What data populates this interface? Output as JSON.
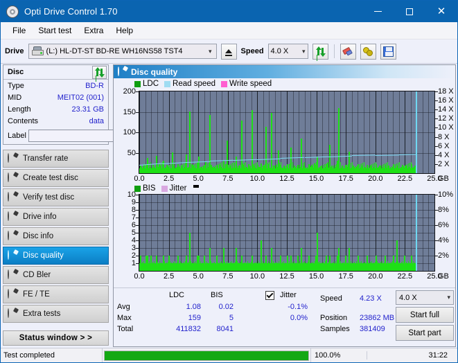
{
  "window": {
    "title": "Opti Drive Control 1.70",
    "icon": "disc-icon",
    "minimize": "–",
    "maximize": "□",
    "close": "✕"
  },
  "menu": {
    "items": [
      {
        "label": "File"
      },
      {
        "label": "Start test"
      },
      {
        "label": "Extra"
      },
      {
        "label": "Help"
      }
    ]
  },
  "toolbar": {
    "drive_label": "Drive",
    "drive_value": "(L:)  HL-DT-ST BD-RE  WH16NS58 TST4",
    "drive_chevron": "⌵",
    "eject_title": "eject-button",
    "speed_label": "Speed",
    "speed_value": "4.0 X",
    "speed_chevron": "⌵",
    "icons": [
      "refresh-icon",
      "eraser-icon",
      "plug-icon",
      "save-icon"
    ]
  },
  "sidebar": {
    "disc_panel": {
      "title": "Disc",
      "refresh_icon": "refresh-icon",
      "rows": [
        {
          "key": "Type",
          "value": "BD-R"
        },
        {
          "key": "MID",
          "value": "MEIT02 (001)"
        },
        {
          "key": "Length",
          "value": "23.31 GB"
        },
        {
          "key": "Contents",
          "value": "data"
        }
      ],
      "label_key": "Label",
      "label_value": "",
      "label_placeholder": "",
      "label_button_icon": "cd-icon"
    },
    "nav": [
      {
        "label": "Transfer rate",
        "active": false
      },
      {
        "label": "Create test disc",
        "active": false
      },
      {
        "label": "Verify test disc",
        "active": false
      },
      {
        "label": "Drive info",
        "active": false
      },
      {
        "label": "Disc info",
        "active": false
      },
      {
        "label": "Disc quality",
        "active": true
      },
      {
        "label": "CD Bler",
        "active": false
      },
      {
        "label": "FE / TE",
        "active": false
      },
      {
        "label": "Extra tests",
        "active": false
      }
    ],
    "status_window_button": "Status window > >"
  },
  "content": {
    "header_title": "Disc quality",
    "header_icon": "disc-quality-icon"
  },
  "stats": {
    "col_headers": [
      "LDC",
      "BIS"
    ],
    "row_labels": [
      "Avg",
      "Max",
      "Total"
    ],
    "ldc": {
      "avg": "1.08",
      "max": "159",
      "total": "411832"
    },
    "bis": {
      "avg": "0.02",
      "max": "5",
      "total": "8041"
    },
    "jitter": {
      "label": "Jitter",
      "checked": true,
      "avg": "-0.1%",
      "max": "0.0%"
    },
    "speed_label": "Speed",
    "speed_value": "4.23 X",
    "position_label": "Position",
    "position_value": "23862 MB",
    "samples_label": "Samples",
    "samples_value": "381409",
    "speed_select_value": "4.0 X",
    "speed_select_chevron": "⌵",
    "start_full": "Start full",
    "start_part": "Start part"
  },
  "statusbar": {
    "text": "Test completed",
    "percent_label": "100.0%",
    "percent_value": 100,
    "time": "31:22"
  },
  "chart_data": [
    {
      "id": "disc-quality-ldc",
      "type": "bar",
      "title": "",
      "xlabel": "GB",
      "ylabel": "",
      "xlim": [
        0,
        25
      ],
      "ylim": [
        0,
        200
      ],
      "y2lim": [
        0,
        18
      ],
      "y2label": "X",
      "grid": true,
      "legend_position": "top-left",
      "legend": [
        {
          "name": "LDC",
          "color": "#0f9e0f"
        },
        {
          "name": "Read speed",
          "color": "#9fdcf2"
        },
        {
          "name": "Write speed",
          "color": "#ff5fd0"
        }
      ],
      "xticks": [
        "0.0",
        "2.5",
        "5.0",
        "7.5",
        "10.0",
        "12.5",
        "15.0",
        "17.5",
        "20.0",
        "22.5",
        "25.0"
      ],
      "yticks": [
        50,
        100,
        150,
        200
      ],
      "y2ticks": [
        2,
        4,
        6,
        8,
        10,
        12,
        14,
        16,
        18
      ],
      "y2ticklabels": [
        "2 X",
        "4 X",
        "6 X",
        "8 X",
        "10 X",
        "12 X",
        "14 X",
        "16 X",
        "18 X"
      ],
      "data_end_x": 23.4,
      "series": [
        {
          "name": "LDC",
          "color": "#1ee016",
          "x": [
            0.05,
            0.2,
            0.35,
            0.5,
            0.65,
            0.8,
            0.95,
            1.1,
            1.25,
            1.4,
            1.55,
            1.7,
            1.85,
            2.0,
            2.15,
            2.3,
            2.45,
            2.6,
            2.75,
            2.9,
            3.05,
            3.2,
            3.35,
            3.5,
            3.65,
            3.8,
            3.95,
            4.1,
            4.25,
            4.4,
            4.55,
            4.7,
            4.85,
            5.0,
            5.15,
            5.3,
            5.45,
            5.6,
            5.75,
            5.9,
            6.05,
            6.2,
            6.35,
            6.5,
            6.65,
            6.8,
            6.95,
            7.1,
            7.25,
            7.4,
            7.55,
            7.7,
            7.85,
            8.0,
            8.15,
            8.3,
            8.45,
            8.6,
            8.75,
            8.9,
            9.05,
            9.2,
            9.35,
            9.5,
            9.65,
            9.8,
            9.95,
            10.1,
            10.25,
            10.4,
            10.55,
            10.7,
            10.85,
            11.0,
            11.15,
            11.3,
            11.45,
            11.6,
            11.75,
            11.9,
            12.05,
            12.2,
            12.35,
            12.5,
            12.65,
            12.8,
            12.95,
            13.1,
            13.25,
            13.4,
            13.55,
            13.7,
            13.85,
            14.0,
            14.15,
            14.3,
            14.45,
            14.6,
            14.75,
            14.9,
            15.05,
            15.2,
            15.35,
            15.5,
            15.65,
            15.8,
            15.95,
            16.1,
            16.25,
            16.4,
            16.55,
            16.7,
            16.85,
            17.0,
            17.15,
            17.3,
            17.45,
            17.6,
            17.75,
            17.9,
            18.05,
            18.2,
            18.35,
            18.5,
            18.65,
            18.8,
            18.95,
            19.1,
            19.25,
            19.4,
            19.55,
            19.7,
            19.85,
            20.0,
            20.15,
            20.3,
            20.45,
            20.6,
            20.75,
            20.9,
            21.05,
            21.2,
            21.35,
            21.5,
            21.65,
            21.8,
            21.95,
            22.1,
            22.25,
            22.4,
            22.55,
            22.7,
            22.85,
            23.0,
            23.15,
            23.3
          ],
          "values": [
            18,
            12,
            22,
            14,
            38,
            16,
            11,
            20,
            13,
            42,
            15,
            18,
            12,
            30,
            14,
            20,
            16,
            11,
            50,
            18,
            13,
            22,
            15,
            19,
            12,
            16,
            45,
            14,
            150,
            22,
            18,
            13,
            24,
            40,
            16,
            12,
            18,
            28,
            15,
            143,
            20,
            13,
            16,
            18,
            12,
            20,
            15,
            30,
            22,
            80,
            14,
            18,
            13,
            25,
            40,
            12,
            18,
            128,
            20,
            14,
            16,
            22,
            12,
            155,
            18,
            13,
            20,
            16,
            24,
            12,
            18,
            113,
            22,
            14,
            147,
            18,
            12,
            16,
            56,
            20,
            14,
            18,
            12,
            22,
            16,
            62,
            14,
            18,
            12,
            20,
            16,
            85,
            18,
            14,
            12,
            22,
            16,
            18,
            13,
            20,
            40,
            14,
            18,
            12,
            16,
            22,
            14,
            70,
            18,
            12,
            16,
            30,
            160,
            14,
            18,
            12,
            20,
            16,
            52,
            14,
            18,
            12,
            16,
            22,
            14,
            18,
            12,
            16,
            20,
            14,
            18,
            12,
            16,
            22,
            14,
            18,
            12,
            16,
            20,
            14,
            18,
            12,
            16,
            22,
            14,
            18,
            12,
            16,
            20,
            14,
            18,
            12,
            16,
            22,
            14,
            18
          ]
        },
        {
          "name": "Read speed",
          "color": "#9fdcf2",
          "x": [
            0.0,
            2.0,
            4.0,
            6.0,
            8.0,
            10.0,
            12.0,
            14.0,
            16.0,
            18.0,
            20.0,
            22.0,
            23.4
          ],
          "values_x": [
            1.8,
            2.2,
            2.5,
            2.7,
            2.9,
            3.1,
            3.3,
            3.5,
            3.7,
            3.9,
            4.0,
            4.1,
            4.2
          ]
        }
      ]
    },
    {
      "id": "disc-quality-bis",
      "type": "bar",
      "title": "",
      "xlabel": "GB",
      "ylabel": "",
      "xlim": [
        0,
        25
      ],
      "ylim": [
        0,
        10
      ],
      "y2lim": [
        0,
        10
      ],
      "y2label": "%",
      "grid": true,
      "legend_position": "top-left",
      "legend": [
        {
          "name": "BIS",
          "color": "#0f9e0f"
        },
        {
          "name": "Jitter",
          "color": "#d9a8e0"
        }
      ],
      "xticks": [
        "0.0",
        "2.5",
        "5.0",
        "7.5",
        "10.0",
        "12.5",
        "15.0",
        "17.5",
        "20.0",
        "22.5",
        "25.0"
      ],
      "yticks": [
        1,
        2,
        3,
        4,
        5,
        6,
        7,
        8,
        9,
        10
      ],
      "y2ticks": [
        2,
        4,
        6,
        8,
        10
      ],
      "y2ticklabels": [
        "2%",
        "4%",
        "6%",
        "8%",
        "10%"
      ],
      "data_end_x": 23.4,
      "series": [
        {
          "name": "BIS",
          "color": "#1ee016",
          "x": [
            0.05,
            0.2,
            0.35,
            0.5,
            0.65,
            0.8,
            0.95,
            1.1,
            1.25,
            1.4,
            1.55,
            1.7,
            1.85,
            2.0,
            2.15,
            2.3,
            2.45,
            2.6,
            2.75,
            2.9,
            3.05,
            3.2,
            3.35,
            3.5,
            3.65,
            3.8,
            3.95,
            4.1,
            4.25,
            4.4,
            4.55,
            4.7,
            4.85,
            5.0,
            5.15,
            5.3,
            5.45,
            5.6,
            5.75,
            5.9,
            6.05,
            6.2,
            6.35,
            6.5,
            6.65,
            6.8,
            6.95,
            7.1,
            7.25,
            7.4,
            7.55,
            7.7,
            7.85,
            8.0,
            8.15,
            8.3,
            8.45,
            8.6,
            8.75,
            8.9,
            9.05,
            9.2,
            9.35,
            9.5,
            9.65,
            9.8,
            9.95,
            10.1,
            10.25,
            10.4,
            10.55,
            10.7,
            10.85,
            11.0,
            11.15,
            11.3,
            11.45,
            11.6,
            11.75,
            11.9,
            12.05,
            12.2,
            12.35,
            12.5,
            12.65,
            12.8,
            12.95,
            13.1,
            13.25,
            13.4,
            13.55,
            13.7,
            13.85,
            14.0,
            14.15,
            14.3,
            14.45,
            14.6,
            14.75,
            14.9,
            15.05,
            15.2,
            15.35,
            15.5,
            15.65,
            15.8,
            15.95,
            16.1,
            16.25,
            16.4,
            16.55,
            16.7,
            16.85,
            17.0,
            17.15,
            17.3,
            17.45,
            17.6,
            17.75,
            17.9,
            18.05,
            18.2,
            18.35,
            18.5,
            18.65,
            18.8,
            18.95,
            19.1,
            19.25,
            19.4,
            19.55,
            19.7,
            19.85,
            20.0,
            20.15,
            20.3,
            20.45,
            20.6,
            20.75,
            20.9,
            21.05,
            21.2,
            21.35,
            21.5,
            21.65,
            21.8,
            21.95,
            22.1,
            22.25,
            22.4,
            22.55,
            22.7,
            22.85,
            23.0,
            23.15,
            23.3
          ],
          "values": [
            2,
            1,
            1,
            2,
            2,
            1,
            2,
            1,
            1,
            2,
            1,
            1,
            1,
            2,
            1,
            1,
            2,
            1,
            1,
            1,
            1,
            2,
            1,
            1,
            1,
            1,
            2,
            1,
            5,
            1,
            1,
            1,
            2,
            2,
            1,
            1,
            2,
            1,
            1,
            3,
            1,
            1,
            1,
            2,
            1,
            1,
            1,
            3,
            1,
            1,
            1,
            1,
            1,
            1,
            3,
            1,
            1,
            2,
            1,
            1,
            1,
            1,
            1,
            2,
            1,
            1,
            1,
            1,
            4,
            1,
            1,
            2,
            1,
            1,
            3,
            1,
            1,
            1,
            1,
            2,
            1,
            1,
            1,
            2,
            1,
            2,
            1,
            1,
            1,
            2,
            1,
            3,
            1,
            1,
            1,
            2,
            1,
            1,
            1,
            2,
            5,
            1,
            1,
            1,
            1,
            2,
            1,
            2,
            1,
            1,
            1,
            2,
            3,
            1,
            1,
            1,
            2,
            1,
            3,
            1,
            1,
            1,
            1,
            2,
            1,
            1,
            1,
            1,
            2,
            1,
            1,
            1,
            1,
            2,
            1,
            1,
            1,
            1,
            2,
            1,
            1,
            1,
            1,
            2,
            1,
            4,
            1,
            1,
            1,
            2,
            1,
            1,
            1,
            2,
            1,
            1,
            1,
            1
          ]
        }
      ]
    }
  ]
}
